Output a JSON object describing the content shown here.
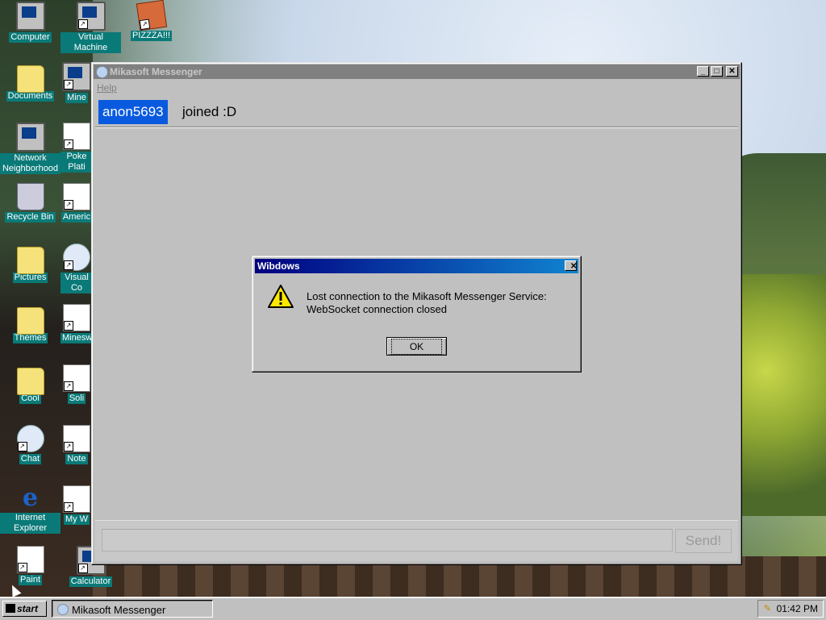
{
  "desktop": {
    "icons": [
      {
        "label": "Computer",
        "icon": "computer-icon"
      },
      {
        "label": "Virtual Machine",
        "icon": "computer-icon"
      },
      {
        "label": "PIZZZA!!!",
        "icon": "pizza-icon"
      },
      {
        "label": "Documents",
        "icon": "folder-icon"
      },
      {
        "label": "Mine",
        "icon": "app-icon"
      },
      {
        "label": "Network Neighborhood",
        "icon": "network-icon"
      },
      {
        "label": "Poke Plati",
        "icon": "app-icon"
      },
      {
        "label": "Recycle Bin",
        "icon": "recycle-bin-icon"
      },
      {
        "label": "Americ",
        "icon": "flag-icon"
      },
      {
        "label": "Pictures",
        "icon": "folder-icon"
      },
      {
        "label": "Visual Co",
        "icon": "app-icon"
      },
      {
        "label": "Themes",
        "icon": "folder-icon"
      },
      {
        "label": "Minesw",
        "icon": "app-icon"
      },
      {
        "label": "Cool",
        "icon": "folder-icon"
      },
      {
        "label": "Soli",
        "icon": "app-icon"
      },
      {
        "label": "Chat",
        "icon": "chat-icon"
      },
      {
        "label": "Note",
        "icon": "app-icon"
      },
      {
        "label": "Internet Explorer",
        "icon": "internet-explorer-icon"
      },
      {
        "label": "My W",
        "icon": "app-icon"
      },
      {
        "label": "Paint",
        "icon": "paint-icon"
      },
      {
        "label": "Calculator",
        "icon": "calculator-icon"
      }
    ]
  },
  "messenger": {
    "title": "Mikasoft Messenger",
    "menu_help": "Help",
    "controls": {
      "minimize": "_",
      "maximize": "□",
      "close": "✕"
    },
    "messages": [
      {
        "user": "anon5693",
        "text": "joined :D"
      }
    ],
    "input_value": "",
    "send_label": "Send!"
  },
  "dialog": {
    "title": "Wibdows",
    "close": "✕",
    "message_line1": "Lost connection to the Mikasoft Messenger Service:",
    "message_line2": "WebSocket connection closed",
    "ok_label": "OK"
  },
  "taskbar": {
    "start_label": "start",
    "task_label": "Mikasoft Messenger",
    "clock": "01:42 PM"
  }
}
